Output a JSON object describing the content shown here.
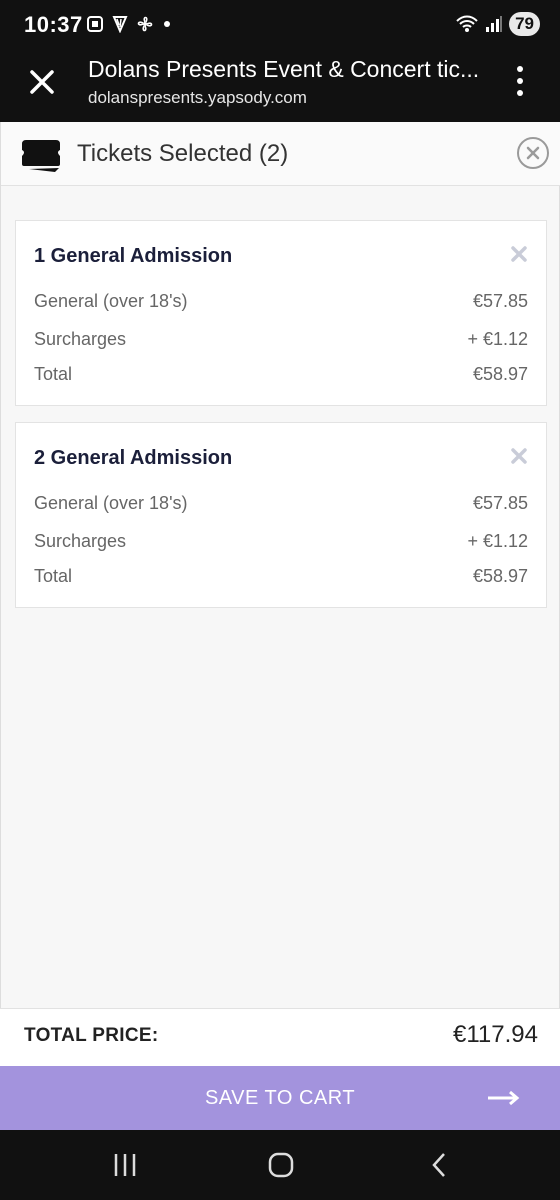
{
  "status_bar": {
    "time": "10:37",
    "battery": "79",
    "left_icons": [
      "screenshot-icon",
      "harp-icon",
      "fan-icon",
      "dot-icon"
    ],
    "right_icons": [
      "wifi-icon",
      "signal-icon",
      "battery-icon"
    ]
  },
  "browser": {
    "title": "Dolans Presents Event & Concert tic...",
    "url": "dolanspresents.yapsody.com"
  },
  "panel": {
    "title": "Tickets Selected (2)",
    "tickets": [
      {
        "title": "1 General Admission",
        "rows": [
          {
            "label": "General (over 18's)",
            "value": "€57.85"
          },
          {
            "label": "Surcharges",
            "value": "+ €1.12"
          },
          {
            "label": "Total",
            "value": "€58.97"
          }
        ]
      },
      {
        "title": "2 General Admission",
        "rows": [
          {
            "label": "General (over 18's)",
            "value": "€57.85"
          },
          {
            "label": "Surcharges",
            "value": "+ €1.12"
          },
          {
            "label": "Total",
            "value": "€58.97"
          }
        ]
      }
    ]
  },
  "footer": {
    "total_label": "TOTAL PRICE:",
    "total_value": "€117.94",
    "cta_label": "SAVE TO CART"
  },
  "colors": {
    "accent": "#a393dd",
    "system_bar": "#111111",
    "card_title": "#1b1f3a"
  }
}
